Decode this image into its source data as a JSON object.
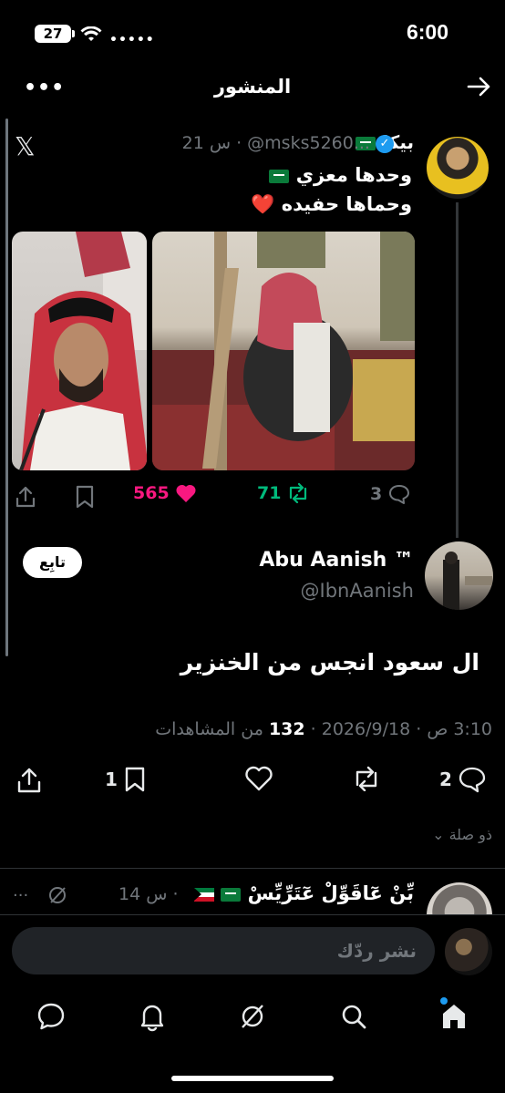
{
  "status_bar": {
    "battery": "27",
    "time": "6:00"
  },
  "header": {
    "title": "المنشور"
  },
  "quoted_post": {
    "name": "بيكا",
    "handle_time": "21 س · @msks5260...",
    "line1": "وحدها معزي",
    "line2": "وحماها حفيده",
    "heart_emoji": "❤️",
    "likes": "565",
    "reposts": "71",
    "replies": "3"
  },
  "main_post": {
    "follow_label": "تابِع",
    "name": "Abu Aanish ™",
    "handle": "@IbnAanish",
    "text": "ال سعود انجس من الخنزير",
    "date": "2026/9/18",
    "time": "3:10 ص",
    "views_count": "132",
    "views_label": "من المشاهدات",
    "replies": "2",
    "likes": "",
    "bookmarks": "1"
  },
  "relevant_label": "ذو صلة",
  "next_post": {
    "name": "بِّنْ عٓاقَوِّلْ عٓتَرِّيِّسْ",
    "meta": "14 س ·"
  },
  "reply_placeholder": "نشر ردّك",
  "colors": {
    "accent": "#1d9bf0",
    "like": "#f91880",
    "repost": "#00ba7c"
  }
}
